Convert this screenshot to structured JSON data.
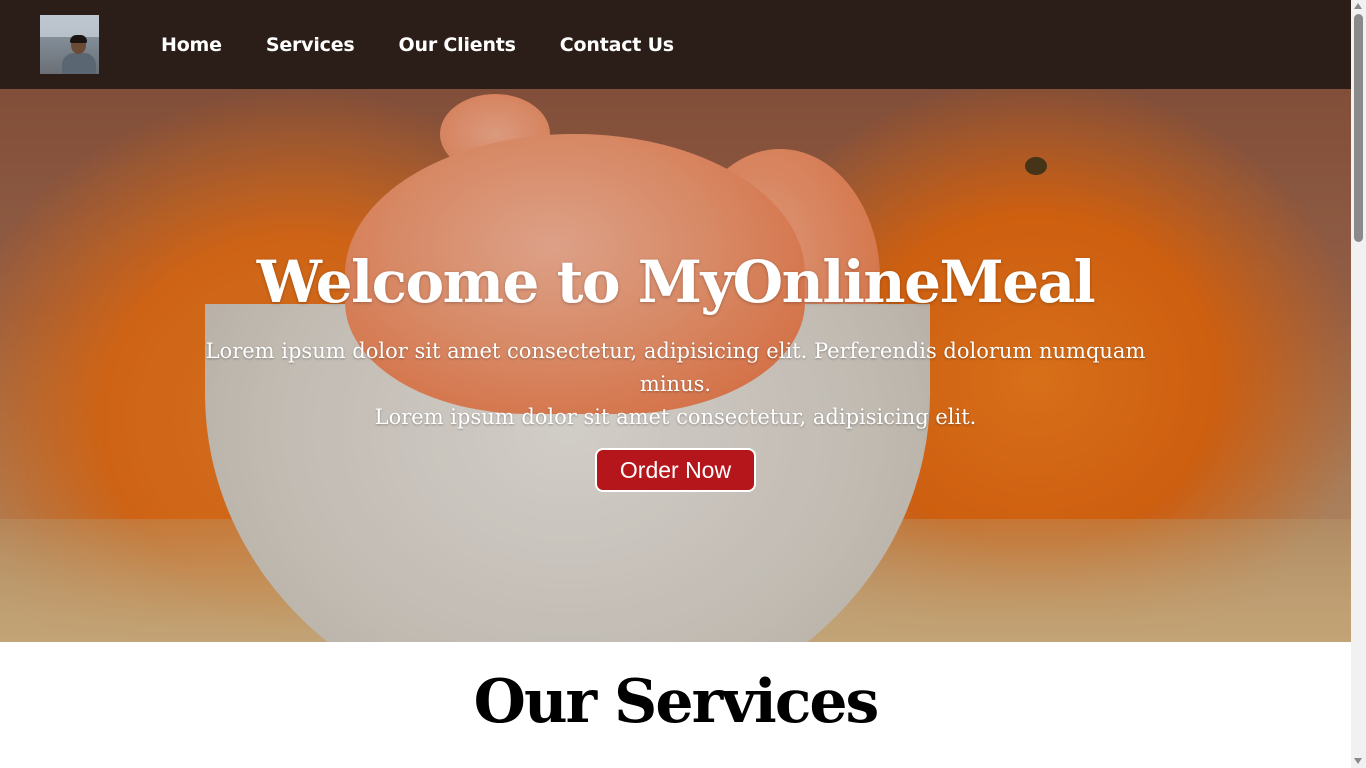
{
  "navbar": {
    "logo_alt": "profile photo",
    "links": [
      "Home",
      "Services",
      "Our Clients",
      "Contact Us"
    ]
  },
  "hero": {
    "title": "Welcome to MyOnlineMeal",
    "text_line1": "Lorem ipsum dolor sit amet consectetur, adipisicing elit. Perferendis dolorum numquam minus.",
    "text_line2": "Lorem ipsum dolor sit amet consectetur, adipisicing elit.",
    "button_label": "Order Now",
    "button_color": "#b5161b",
    "image_subject": "peeled orange segments in a white bowl with oranges behind"
  },
  "services": {
    "title": "Our Services"
  },
  "colors": {
    "navbar_bg": "#2b1d17",
    "accent": "#b5161b"
  }
}
